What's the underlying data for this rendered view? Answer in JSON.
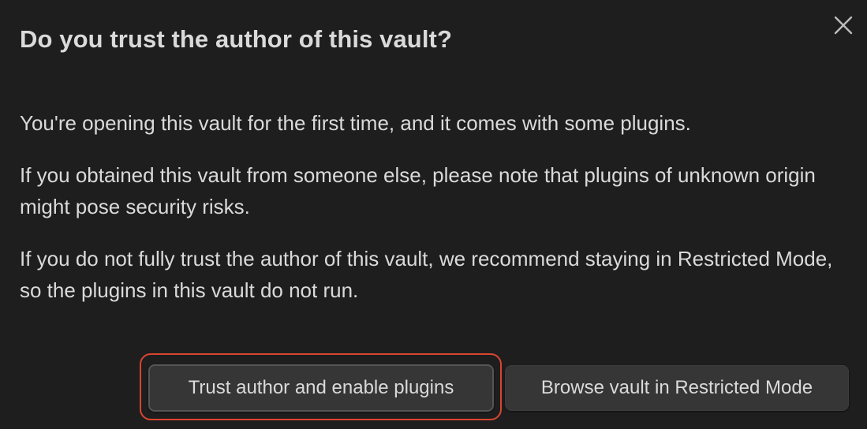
{
  "dialog": {
    "title": "Do you trust the author of this vault?",
    "paragraphs": [
      "You're opening this vault for the first time, and it comes with some plugins.",
      "If you obtained this vault from someone else, please note that plugins of unknown origin might pose security risks.",
      "If you do not fully trust the author of this vault, we recommend staying in Restricted Mode, so the plugins in this vault do not run."
    ],
    "close_icon": "close-icon",
    "buttons": {
      "trust_label": "Trust author and enable plugins",
      "restricted_label": "Browse vault in Restricted Mode"
    },
    "colors": {
      "background": "#1e1e1e",
      "text": "#dadada",
      "button_bg": "#363636",
      "focus_ring": "#d9452f"
    }
  }
}
